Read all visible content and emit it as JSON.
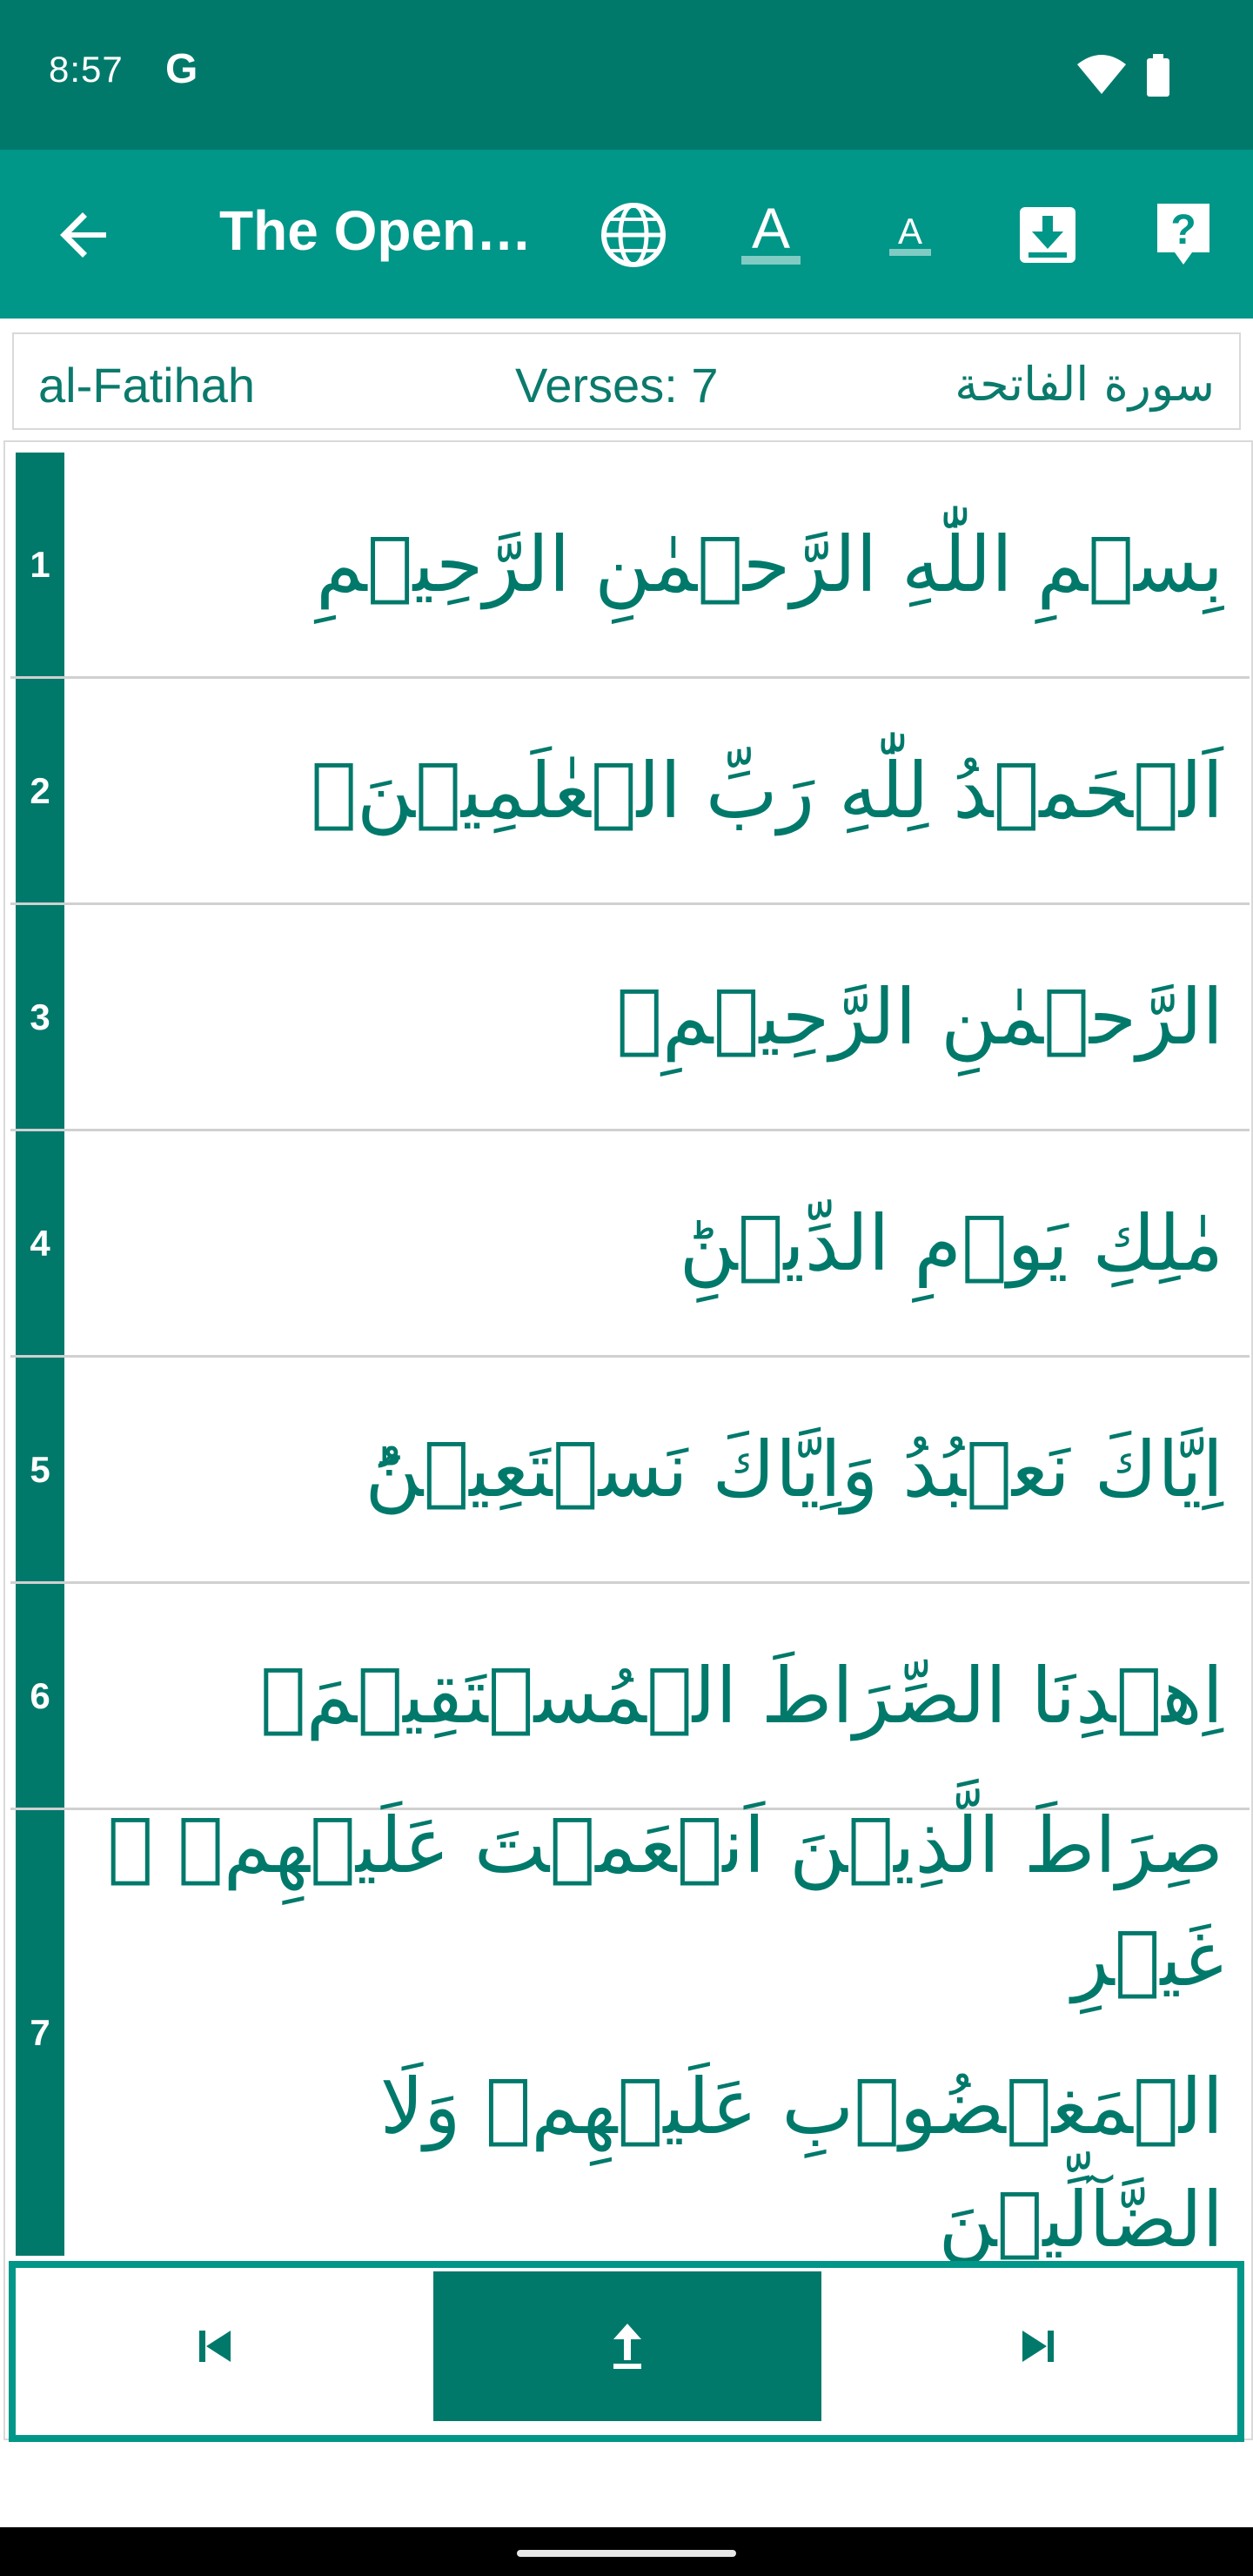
{
  "status_bar": {
    "time": "8:57",
    "g_letter": "G"
  },
  "app_bar": {
    "title": "The Open…",
    "actions": [
      "globe-icon",
      "font-increase-icon",
      "font-decrease-icon",
      "download-icon",
      "help-icon"
    ],
    "font_increase_label": "A",
    "font_decrease_label": "A",
    "help_label": "?"
  },
  "surah_info": {
    "name": "al-Fatihah",
    "verses": "Verses: 7",
    "arabic_name": "سورة الفاتحة"
  },
  "verses": [
    {
      "number": "1",
      "text": "بِسۡمِ اللّٰهِ الرَّحۡمٰنِ الرَّحِيۡمِ"
    },
    {
      "number": "2",
      "text": "اَلۡحَمۡدُ لِلّٰهِ رَبِّ الۡعٰلَمِيۡنَۙ"
    },
    {
      "number": "3",
      "text": "الرَّحۡمٰنِ الرَّحِيۡمِۙ"
    },
    {
      "number": "4",
      "text": "مٰلِكِ يَوۡمِ الدِّيۡنِؕ"
    },
    {
      "number": "5",
      "text": "اِيَّاكَ نَعۡبُدُ وَاِيَّاكَ نَسۡتَعِيۡنُؕ"
    },
    {
      "number": "6",
      "text": "اِهۡدِنَا الصِّرَاطَ الۡمُسۡتَقِيۡمَۙ"
    },
    {
      "number": "7",
      "text_line1": "صِرَاطَ الَّذِيۡنَ اَنۡعَمۡتَ عَلَيۡهِمۡ ۙ غَيۡرِ",
      "text_line2": "الۡمَغۡضُوۡبِ عَلَيۡهِمۡ وَلَا الضَّآلِّيۡنَ‏"
    }
  ],
  "colors": {
    "status_bar": "#00796B",
    "app_bar": "#009688",
    "accent_text": "#00796B",
    "verse_number_bg": "#00796B"
  },
  "nav_buttons": [
    "skip-previous-icon",
    "scroll-top-icon",
    "skip-next-icon"
  ]
}
